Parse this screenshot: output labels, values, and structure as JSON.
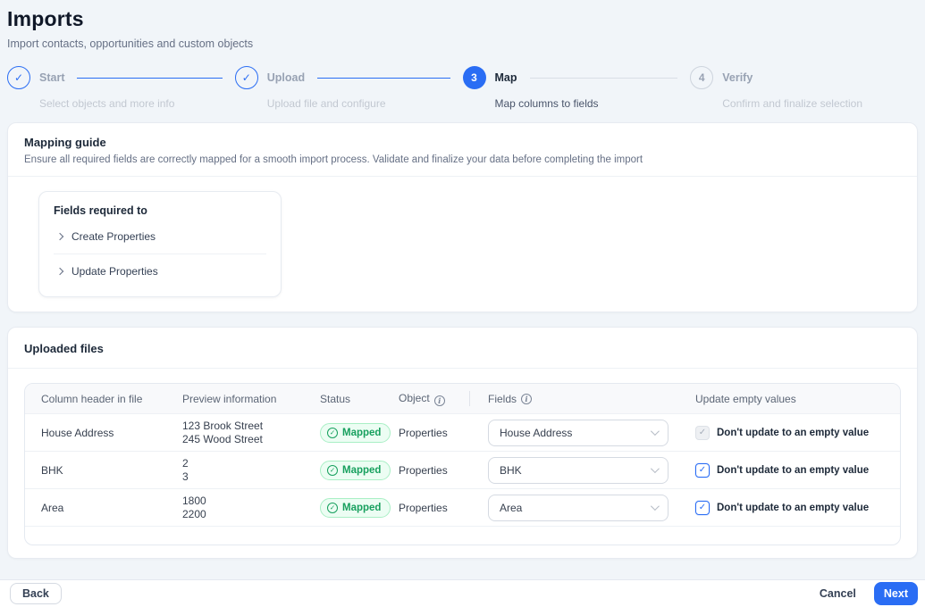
{
  "page": {
    "title": "Imports",
    "subtitle": "Import contacts, opportunities and custom objects"
  },
  "stepper": {
    "steps": [
      {
        "indicator": "check",
        "label": "Start",
        "description": "Select objects and more info",
        "state": "done"
      },
      {
        "indicator": "check",
        "label": "Upload",
        "description": "Upload file and configure",
        "state": "done"
      },
      {
        "indicator": "3",
        "label": "Map",
        "description": "Map columns to fields",
        "state": "active"
      },
      {
        "indicator": "4",
        "label": "Verify",
        "description": "Confirm and finalize selection",
        "state": "pending"
      }
    ]
  },
  "mapping_guide": {
    "title": "Mapping guide",
    "description": "Ensure all required fields are correctly mapped for a smooth import process. Validate and finalize your data before completing the import",
    "fields_required": {
      "title": "Fields required to",
      "items": [
        "Create Properties",
        "Update Properties"
      ]
    }
  },
  "uploaded_files": {
    "title": "Uploaded files",
    "table": {
      "columns": [
        "Column header in file",
        "Preview information",
        "Status",
        "Object",
        "Fields",
        "Update empty values"
      ],
      "rows": [
        {
          "column_header": "House Address",
          "preview": [
            "123 Brook Street",
            "245 Wood Street"
          ],
          "status": "Mapped",
          "object": "Properties",
          "field": "House Address",
          "checkbox": {
            "checked": true,
            "disabled": true,
            "label": "Don't update to an empty value"
          }
        },
        {
          "column_header": "BHK",
          "preview": [
            "2",
            "3"
          ],
          "status": "Mapped",
          "object": "Properties",
          "field": "BHK",
          "checkbox": {
            "checked": true,
            "disabled": false,
            "label": "Don't update to an empty value"
          }
        },
        {
          "column_header": "Area",
          "preview": [
            "1800",
            "2200"
          ],
          "status": "Mapped",
          "object": "Properties",
          "field": "Area",
          "checkbox": {
            "checked": true,
            "disabled": false,
            "label": "Don't update to an empty value"
          }
        }
      ]
    }
  },
  "footer": {
    "back": "Back",
    "cancel": "Cancel",
    "next": "Next"
  },
  "colors": {
    "accent_blue": "#2a6df4",
    "success_green": "#17a05e",
    "success_bg": "#ecfdf3",
    "page_bg": "#f1f5f9"
  }
}
